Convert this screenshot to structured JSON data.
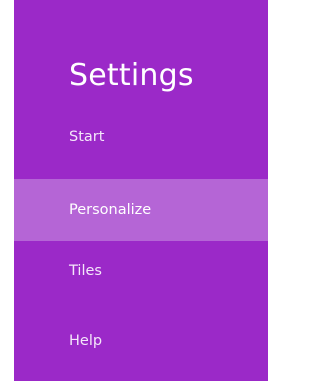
{
  "pane": {
    "title": "Settings",
    "items": [
      {
        "label": "Start",
        "selected": false
      },
      {
        "label": "Personalize",
        "selected": true
      },
      {
        "label": "Tiles",
        "selected": false
      },
      {
        "label": "Help",
        "selected": false
      }
    ]
  },
  "colors": {
    "pane_background": "#9b29c8",
    "selected_item_background": "#b565d6",
    "text": "#ffffff"
  }
}
